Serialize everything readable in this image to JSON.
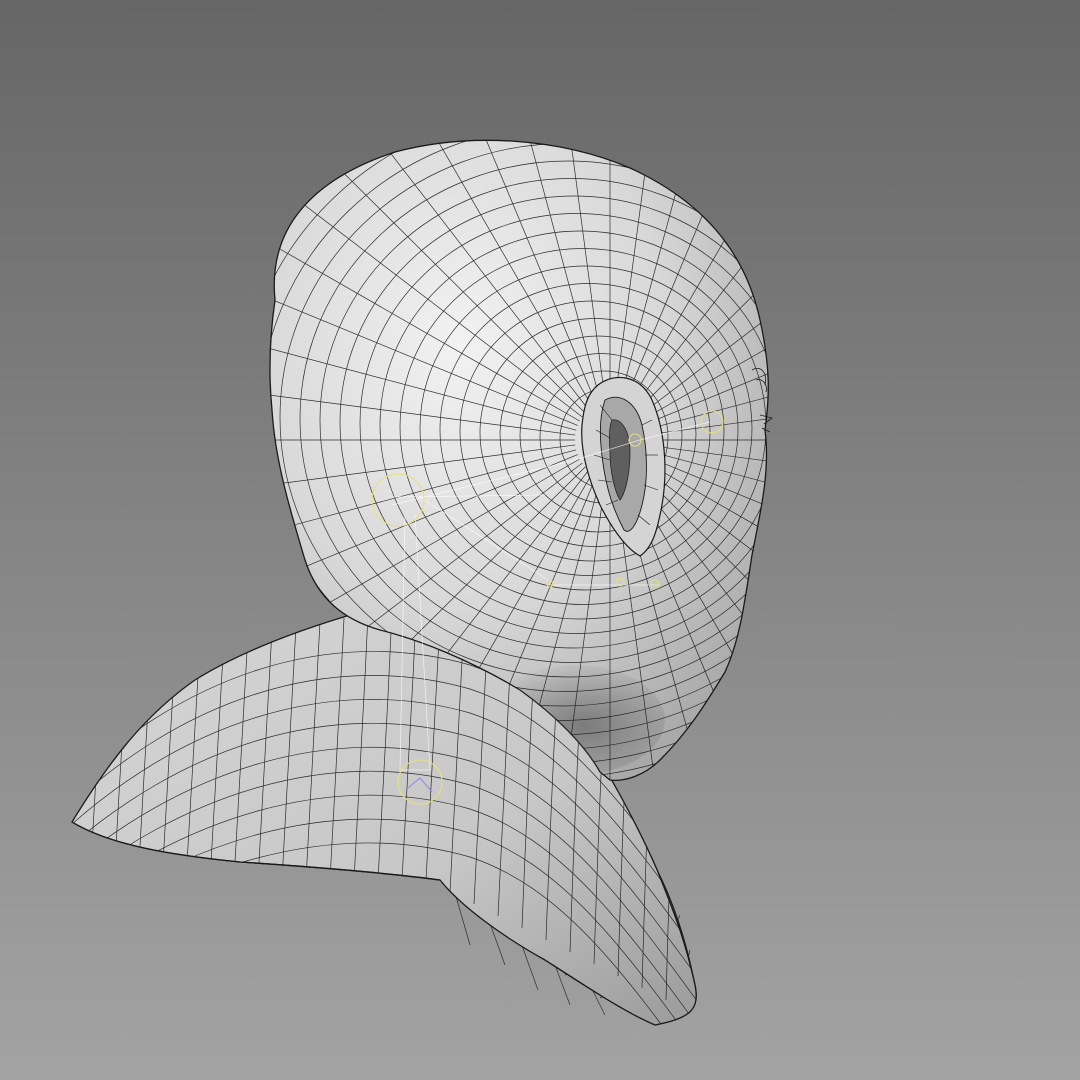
{
  "viewport": {
    "background_top": "#666666",
    "background_bottom": "#a3a3a3"
  },
  "model": {
    "surface_light": "#f2f2f2",
    "surface_mid": "#c9c9c9",
    "surface_dark": "#3f3f3f",
    "wire_color": "#1a1a1a",
    "rig_handle_color": "#e6e07a",
    "rig_line_color": "#ffffff"
  }
}
